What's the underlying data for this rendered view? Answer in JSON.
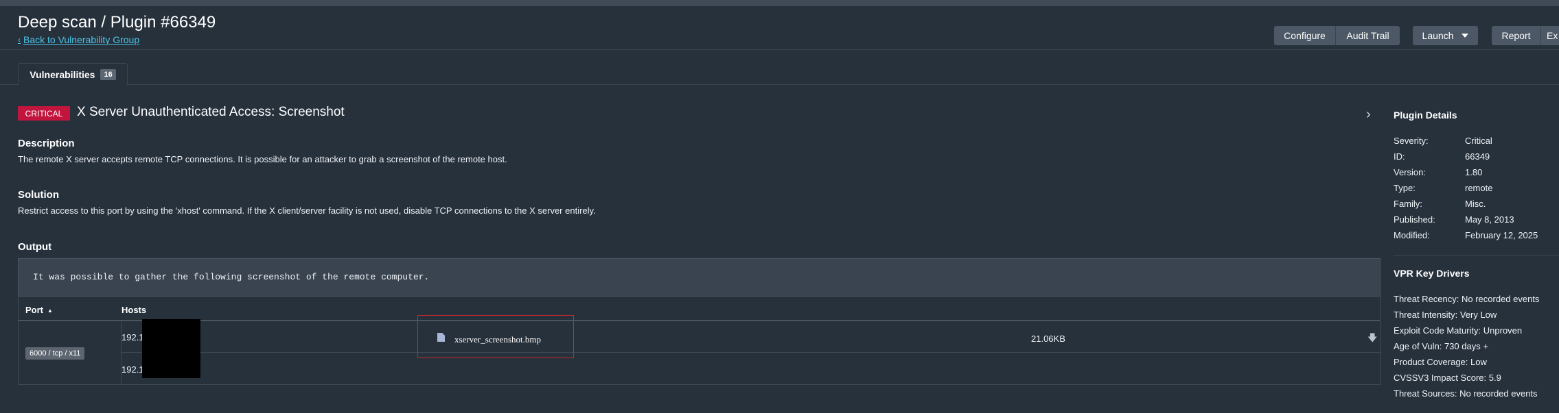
{
  "header": {
    "title": "Deep scan / Plugin #66349",
    "back_link": "Back to Vulnerability Group",
    "buttons": {
      "configure": "Configure",
      "audit_trail": "Audit Trail",
      "launch": "Launch",
      "report": "Report",
      "export": "Ex"
    }
  },
  "tabs": [
    {
      "label": "Vulnerabilities",
      "count": "16"
    }
  ],
  "vulnerability": {
    "severity": "CRITICAL",
    "title": "X Server Unauthenticated Access: Screenshot",
    "description_title": "Description",
    "description": "The remote X server accepts remote TCP connections. It is possible for an attacker to grab a screenshot of the remote host.",
    "solution_title": "Solution",
    "solution": "Restrict access to this port by using the 'xhost' command. If the X client/server facility is not used, disable TCP connections to the X server entirely.",
    "output_title": "Output",
    "output_text": "It was possible to gather the following screenshot of the remote computer."
  },
  "table": {
    "headers": {
      "port": "Port",
      "hosts": "Hosts"
    },
    "port": "6000 / tcp / x11",
    "hosts": [
      "192.1",
      "192.1"
    ],
    "attachment": {
      "name": "xserver_screenshot.bmp",
      "size": "21.06KB"
    }
  },
  "plugin_details": {
    "title": "Plugin Details",
    "rows": [
      {
        "label": "Severity:",
        "value": "Critical"
      },
      {
        "label": "ID:",
        "value": "66349"
      },
      {
        "label": "Version:",
        "value": "1.80"
      },
      {
        "label": "Type:",
        "value": "remote"
      },
      {
        "label": "Family:",
        "value": "Misc."
      },
      {
        "label": "Published:",
        "value": "May 8, 2013"
      },
      {
        "label": "Modified:",
        "value": "February 12, 2025"
      }
    ]
  },
  "vpr": {
    "title": "VPR Key Drivers",
    "rows": [
      "Threat Recency: No recorded events",
      "Threat Intensity: Very Low",
      "Exploit Code Maturity: Unproven",
      "Age of Vuln: 730 days +",
      "Product Coverage: Low",
      "CVSSV3 Impact Score: 5.9",
      "Threat Sources: No recorded events"
    ]
  },
  "colors": {
    "background": "#27313c",
    "critical": "#c1153d",
    "link": "#4cc6ea",
    "button": "#4c5866",
    "highlight": "#c9282e"
  }
}
